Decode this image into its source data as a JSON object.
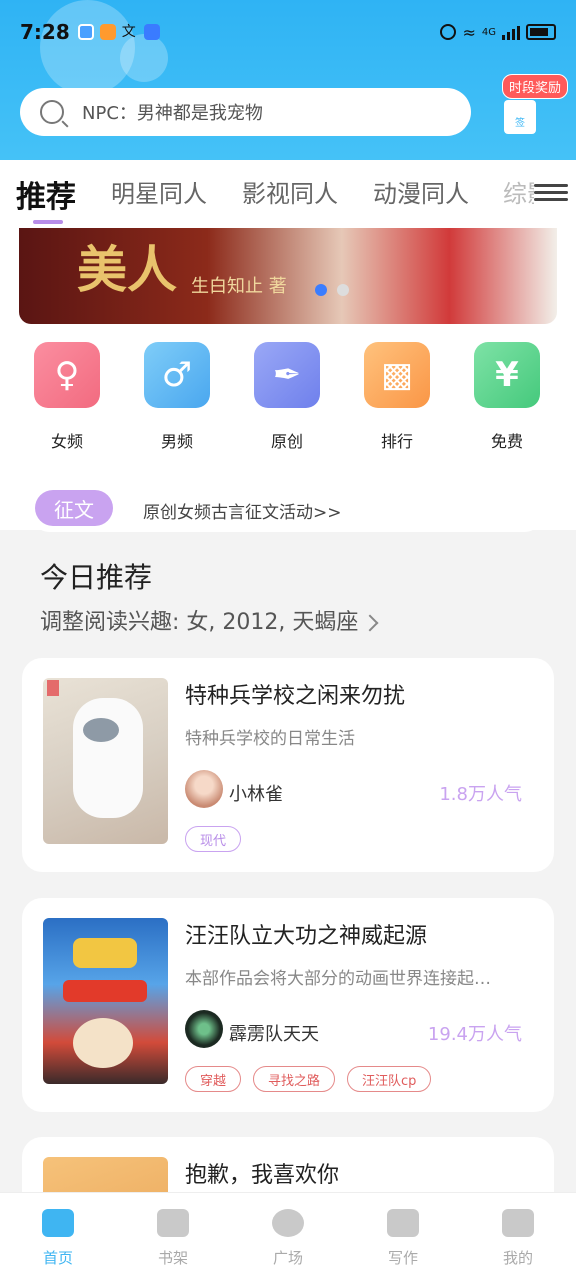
{
  "status": {
    "time": "7:28",
    "net": "4G"
  },
  "search": {
    "placeholder": "NPC：男神都是我宠物"
  },
  "reward": {
    "badge": "时段奖励",
    "sign": "签"
  },
  "tabs": [
    "推荐",
    "明星同人",
    "影视同人",
    "动漫同人",
    "综影"
  ],
  "banner": {
    "title": "美人",
    "author": "生白知止 著"
  },
  "categories": [
    {
      "label": "女频",
      "icon": "female-icon",
      "color": "#f47b8d"
    },
    {
      "label": "男频",
      "icon": "male-icon",
      "color": "#5cb7f3"
    },
    {
      "label": "原创",
      "icon": "pen-icon",
      "color": "#7b8ff0"
    },
    {
      "label": "排行",
      "icon": "podium-icon",
      "color": "#fba25f"
    },
    {
      "label": "免费",
      "icon": "yen-icon",
      "color": "#56d48a"
    }
  ],
  "notice": {
    "pill": "征文",
    "text": "原创女频古言征文活动>>"
  },
  "today": {
    "title": "今日推荐",
    "interest": "调整阅读兴趣: 女, 2012, 天蝎座"
  },
  "books": [
    {
      "name": "特种兵学校之闲来勿扰",
      "desc": "特种兵学校的日常生活",
      "author": "小林雀",
      "popularity": "1.8万人气",
      "tags": [
        "现代"
      ]
    },
    {
      "name": "汪汪队立大功之神威起源",
      "desc": "本部作品会将大部分的动画世界连接起…",
      "author": "霹雳队天天",
      "popularity": "19.4万人气",
      "tags": [
        "穿越",
        "寻找之路",
        "汪汪队cp"
      ]
    },
    {
      "name": "抱歉，我喜欢你"
    }
  ],
  "nav": [
    "首页",
    "书架",
    "广场",
    "写作",
    "我的"
  ]
}
